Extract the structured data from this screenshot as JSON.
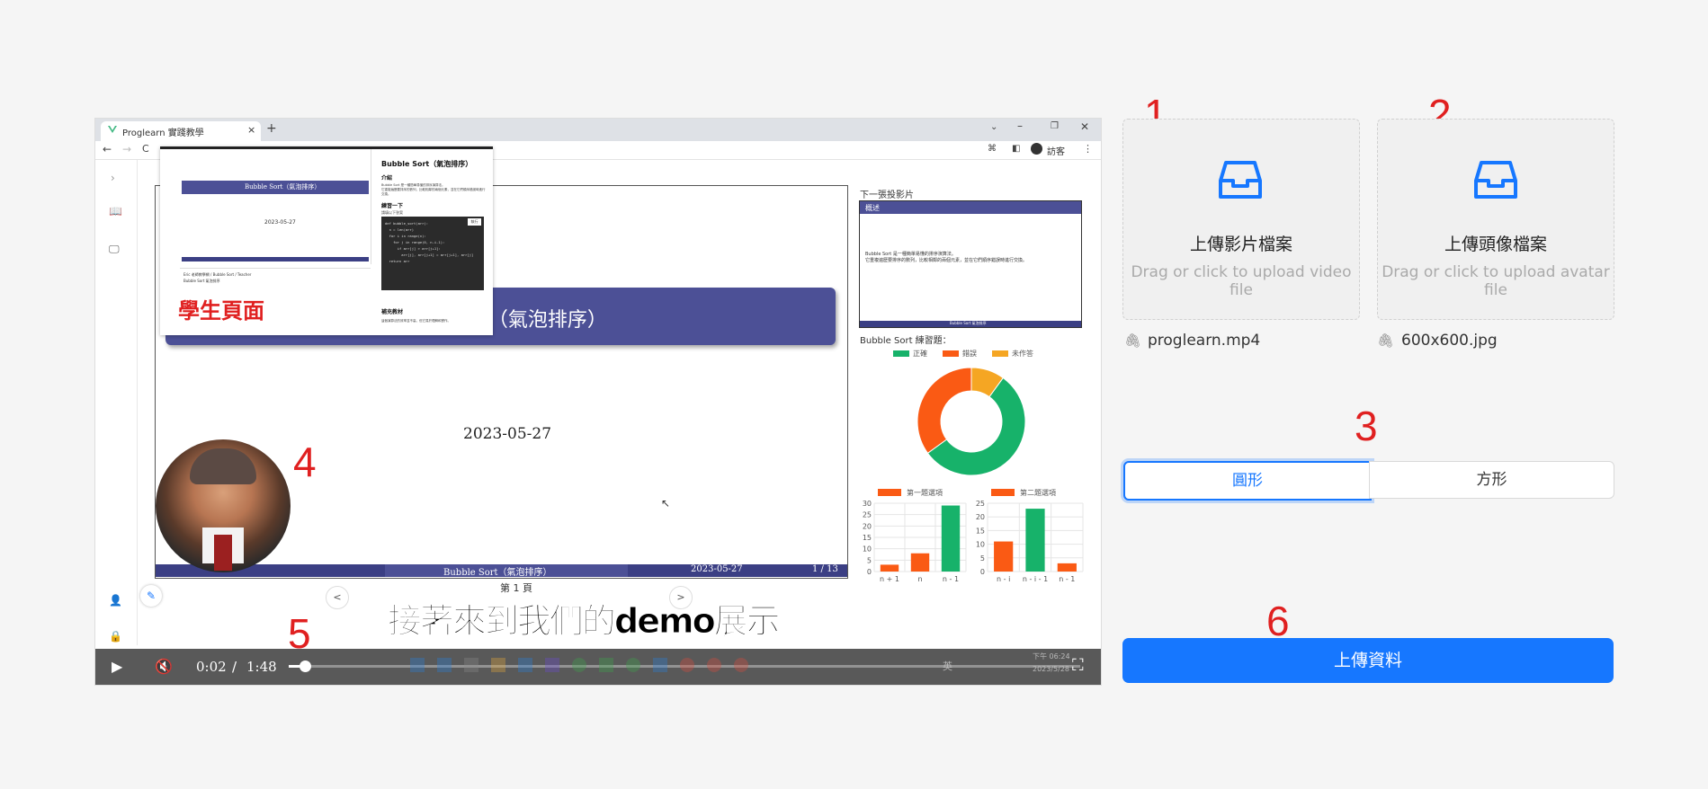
{
  "colors": {
    "accent": "#1677ff",
    "marker": "#e02020",
    "slide_banner": "#4c5096",
    "correct": "#17b26a",
    "wrong": "#fa5a14",
    "pending": "#f5a623"
  },
  "markers": [
    "1",
    "2",
    "3",
    "4",
    "5",
    "6"
  ],
  "browser": {
    "tab_title": "Proglearn 實踐教學",
    "tab_close": "×",
    "tab_new": "+",
    "guest_label": "訪客"
  },
  "overlay": {
    "banner_text": "Bubble Sort（氣泡排序）",
    "date": "2023-05-27",
    "heading": "Bubble Sort（氣泡排序）",
    "intro_title": "介紹",
    "intro_text": "Bubble Sort 是一種簡單易懂的排序演算法。\n它重複遍歷要排序的數列，比較相鄰的兩個元素，並在它們順序錯誤時進行交換。",
    "practice_title": "練習一下",
    "practice_hint": "請填以下答案",
    "code_lines": [
      "def bubble_sort(arr):",
      "  n = len(arr)",
      "  for i in range(n):",
      "    for j in range(0, n-i-1):",
      "      if arr[j] > arr[j+1]:",
      "        arr[j], arr[j+1] = arr[j+1], arr[j]",
      "  return arr"
    ],
    "run_button": "執行",
    "supplement_title": "補充教材",
    "supplement_text": "這個演算法的效率並不高，但它易於理解和實作。",
    "crumb": "Eric 老師教學網 / Bubble Sort / Teacher",
    "crumb2": "Bubble Sort 氣泡排序",
    "student_label": "學生頁面"
  },
  "slide": {
    "title": "Bubble Sort（氣泡排序）",
    "title_visible": "t（氣泡排序）",
    "date": "2023-05-27",
    "footer_center": "Bubble Sort（氣泡排序）",
    "footer_date": "2023-05-27",
    "footer_page": "1 / 13",
    "page_label": "第 1 頁",
    "prev": "<",
    "next": ">"
  },
  "next_slide": {
    "label": "下一張投影片",
    "header": "概述",
    "body": "Bubble Sort 是一種簡單易懂的排序演算法。\n它重複遍歷要排序的數列，比較相鄰的兩個元素，並在它們順序錯誤時進行交換。",
    "footer": "Bubble Sort 氣泡排序"
  },
  "quiz": {
    "title": "Bubble Sort 練習題：",
    "legend": [
      "正確",
      "錯誤",
      "未作答"
    ]
  },
  "chart_data": [
    {
      "type": "pie",
      "categories": [
        "正確",
        "錯誤",
        "未作答"
      ],
      "values": [
        55,
        35,
        10
      ]
    },
    {
      "type": "bar",
      "series": [
        {
          "name": "第一題選項",
          "values": [
            3,
            8,
            29
          ]
        }
      ],
      "categories": [
        "n + 1",
        "n",
        "n - 1"
      ],
      "ylim": [
        0,
        30
      ],
      "yticks": [
        "30",
        "25",
        "20",
        "15",
        "10",
        "5",
        "0"
      ]
    },
    {
      "type": "bar",
      "series": [
        {
          "name": "第二題選項",
          "values": [
            11,
            23,
            3
          ]
        }
      ],
      "categories": [
        "n - i",
        "n - i - 1",
        "n - 1"
      ],
      "ylim": [
        0,
        25
      ],
      "yticks": [
        "25",
        "20",
        "15",
        "10",
        "5",
        "0"
      ]
    }
  ],
  "caption": "接著來到我們的demo展示",
  "player": {
    "current": "0:02",
    "sep": "/",
    "duration": "1:48",
    "progress": 0.02
  },
  "taskbar": {
    "clock": "下午 06:24",
    "date": "2023/5/28",
    "ime": "英"
  },
  "upload_video": {
    "title": "上傳影片檔案",
    "hint": "Drag or click to upload video file",
    "file": "proglearn.mp4"
  },
  "upload_avatar": {
    "title": "上傳頭像檔案",
    "hint": "Drag or click to upload avatar file",
    "file": "600x600.jpg"
  },
  "shape": {
    "options": [
      "圓形",
      "方形"
    ],
    "selected": "圓形"
  },
  "submit": "上傳資料"
}
